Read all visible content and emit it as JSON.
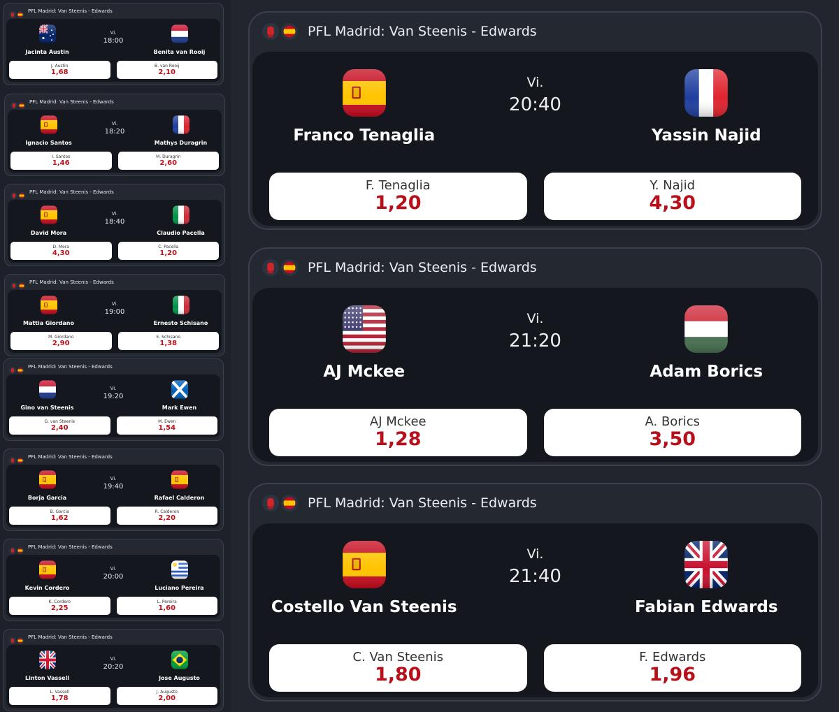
{
  "small_events": [
    {
      "header": "PFL Madrid: Van Steenis - Edwards",
      "day": "Vi.",
      "time": "18:00",
      "home": {
        "name": "Jacinta Austin",
        "short": "J. Austin",
        "odd": "1,68",
        "flag": "australia"
      },
      "away": {
        "name": "Benita van Rooij",
        "short": "B. van Rooij",
        "odd": "2,10",
        "flag": "netherlands"
      }
    },
    {
      "header": "PFL Madrid: Van Steenis - Edwards",
      "day": "Vi.",
      "time": "18:20",
      "home": {
        "name": "Ignacio Santos",
        "short": "I. Santos",
        "odd": "1,46",
        "flag": "spain"
      },
      "away": {
        "name": "Mathys Duragrin",
        "short": "M. Duragrin",
        "odd": "2,60",
        "flag": "france"
      }
    },
    {
      "header": "PFL Madrid: Van Steenis - Edwards",
      "day": "Vi.",
      "time": "18:40",
      "home": {
        "name": "David Mora",
        "short": "D. Mora",
        "odd": "4,30",
        "flag": "spain"
      },
      "away": {
        "name": "Claudio Pacella",
        "short": "C. Pacella",
        "odd": "1,20",
        "flag": "italy"
      }
    },
    {
      "header": "PFL Madrid: Van Steenis - Edwards",
      "day": "Vi.",
      "time": "19:00",
      "home": {
        "name": "Mattia Giordano",
        "short": "M. Giordano",
        "odd": "2,90",
        "flag": "spain"
      },
      "away": {
        "name": "Ernesto Schisano",
        "short": "E. Schisano",
        "odd": "1,38",
        "flag": "italy"
      }
    },
    {
      "header": "PFL Madrid: Van Steenis - Edwards",
      "day": "Vi.",
      "time": "19:20",
      "home": {
        "name": "Gino van Steenis",
        "short": "G. van Steenis",
        "odd": "2,40",
        "flag": "netherlands"
      },
      "away": {
        "name": "Mark Ewen",
        "short": "M. Ewen",
        "odd": "1,54",
        "flag": "scotland"
      }
    },
    {
      "header": "PFL Madrid: Van Steenis - Edwards",
      "day": "Vi.",
      "time": "19:40",
      "home": {
        "name": "Borja Garcia",
        "short": "B. Garcia",
        "odd": "1,62",
        "flag": "spain"
      },
      "away": {
        "name": "Rafael Calderon",
        "short": "R. Calderon",
        "odd": "2,20",
        "flag": "spain"
      }
    },
    {
      "header": "PFL Madrid: Van Steenis - Edwards",
      "day": "Vi.",
      "time": "20:00",
      "home": {
        "name": "Kevin Cordero",
        "short": "K. Cordero",
        "odd": "2,25",
        "flag": "spain"
      },
      "away": {
        "name": "Luciano Pereira",
        "short": "L. Pereira",
        "odd": "1,60",
        "flag": "uruguay"
      }
    },
    {
      "header": "PFL Madrid: Van Steenis - Edwards",
      "day": "Vi.",
      "time": "20:20",
      "home": {
        "name": "Linton Vassell",
        "short": "L. Vassell",
        "odd": "1,78",
        "flag": "uk"
      },
      "away": {
        "name": "Jose Augusto",
        "short": "J. Augusto",
        "odd": "2,00",
        "flag": "brazil"
      }
    }
  ],
  "big_events": [
    {
      "header": "PFL Madrid: Van Steenis - Edwards",
      "day": "Vi.",
      "time": "20:40",
      "home": {
        "name": "Franco Tenaglia",
        "short": "F. Tenaglia",
        "odd": "1,20",
        "flag": "spain"
      },
      "away": {
        "name": "Yassin Najid",
        "short": "Y. Najid",
        "odd": "4,30",
        "flag": "france"
      }
    },
    {
      "header": "PFL Madrid: Van Steenis - Edwards",
      "day": "Vi.",
      "time": "21:20",
      "home": {
        "name": "AJ Mckee",
        "short": "AJ Mckee",
        "odd": "1,28",
        "flag": "usa"
      },
      "away": {
        "name": "Adam Borics",
        "short": "A. Borics",
        "odd": "3,50",
        "flag": "hungary"
      }
    },
    {
      "header": "PFL Madrid: Van Steenis - Edwards",
      "day": "Vi.",
      "time": "21:40",
      "home": {
        "name": "Costello Van Steenis",
        "short": "C. Van Steenis",
        "odd": "1,80",
        "flag": "spain"
      },
      "away": {
        "name": "Fabian Edwards",
        "short": "F. Edwards",
        "odd": "1,96",
        "flag": "uk"
      }
    }
  ],
  "header_icons": [
    "boxing-glove-icon",
    "spain-flag-icon"
  ],
  "colors": {
    "odd_value": "#c0121b",
    "page_bg": "#22252e",
    "card_inner": "#14171e"
  }
}
